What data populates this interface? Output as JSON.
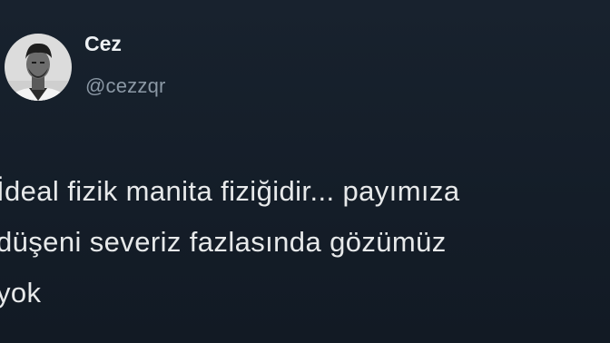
{
  "tweet": {
    "author": {
      "display_name": "Cez",
      "handle": "@cezzqr",
      "avatar_icon": "profile-photo"
    },
    "text_lines": [
      "İdeal fizik manita fiziğidir... payımıza",
      "düşeni severiz fazlasında gözümüz",
      "yok"
    ]
  },
  "colors": {
    "background": "#15202b",
    "text_primary": "#e7e9ea",
    "text_secondary": "#8b98a5"
  }
}
